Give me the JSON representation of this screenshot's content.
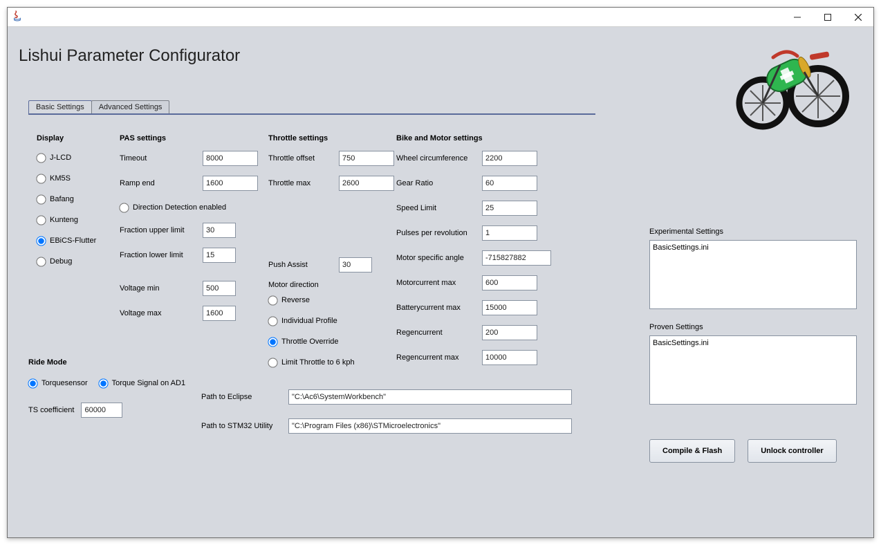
{
  "app_title": "Lishui Parameter Configurator",
  "tabs": {
    "basic": "Basic Settings",
    "advanced": "Advanced Settings"
  },
  "display": {
    "heading": "Display",
    "options": [
      "J-LCD",
      "KM5S",
      "Bafang",
      "Kunteng",
      "EBiCS-Flutter",
      "Debug"
    ],
    "selected": "EBiCS-Flutter"
  },
  "pas": {
    "heading": "PAS settings",
    "timeout_label": "Timeout",
    "timeout": "8000",
    "ramp_end_label": "Ramp end",
    "ramp_end": "1600",
    "direction_detect_label": "Direction Detection enabled",
    "frac_upper_label": "Fraction upper limit",
    "frac_upper": "30",
    "frac_lower_label": "Fraction lower limit",
    "frac_lower": "15",
    "volt_min_label": "Voltage min",
    "volt_min": "500",
    "volt_max_label": "Voltage max",
    "volt_max": "1600"
  },
  "throttle": {
    "heading": "Throttle settings",
    "offset_label": "Throttle offset",
    "offset": "750",
    "max_label": "Throttle max",
    "max": "2600",
    "push_assist_label": "Push Assist",
    "push_assist": "30",
    "motor_dir_label": "Motor direction",
    "options": [
      "Reverse",
      "Individual Profile",
      "Throttle Override",
      "Limit Throttle to 6 kph"
    ],
    "selected": "Throttle Override"
  },
  "bike": {
    "heading": "Bike and Motor settings",
    "wheel_circ_label": "Wheel circumference",
    "wheel_circ": "2200",
    "gear_ratio_label": "Gear Ratio",
    "gear_ratio": "60",
    "speed_limit_label": "Speed Limit",
    "speed_limit": "25",
    "ppr_label": "Pulses per revolution",
    "ppr": "1",
    "motor_angle_label": "Motor specific angle",
    "motor_angle": "-715827882",
    "motor_cur_label": "Motorcurrent max",
    "motor_cur": "600",
    "batt_cur_label": "Batterycurrent max",
    "batt_cur": "15000",
    "regen_label": "Regencurrent",
    "regen": "200",
    "regen_max_label": "Regencurrent max",
    "regen_max": "10000"
  },
  "ride": {
    "heading": "Ride Mode",
    "torque_sensor_label": "Torquesensor",
    "torque_ad1_label": "Torque Signal on AD1",
    "ts_coef_label": "TS coefficient",
    "ts_coef": "60000"
  },
  "paths": {
    "eclipse_label": "Path to Eclipse",
    "eclipse": "\"C:\\Ac6\\SystemWorkbench\"",
    "stm32_label": "Path to STM32 Utility",
    "stm32": "\"C:\\Program Files (x86)\\STMicroelectronics\""
  },
  "experimental": {
    "label": "Experimental Settings",
    "items": [
      "BasicSettings.ini"
    ]
  },
  "proven": {
    "label": "Proven Settings",
    "items": [
      "BasicSettings.ini"
    ]
  },
  "buttons": {
    "compile": "Compile & Flash",
    "unlock": "Unlock controller"
  }
}
